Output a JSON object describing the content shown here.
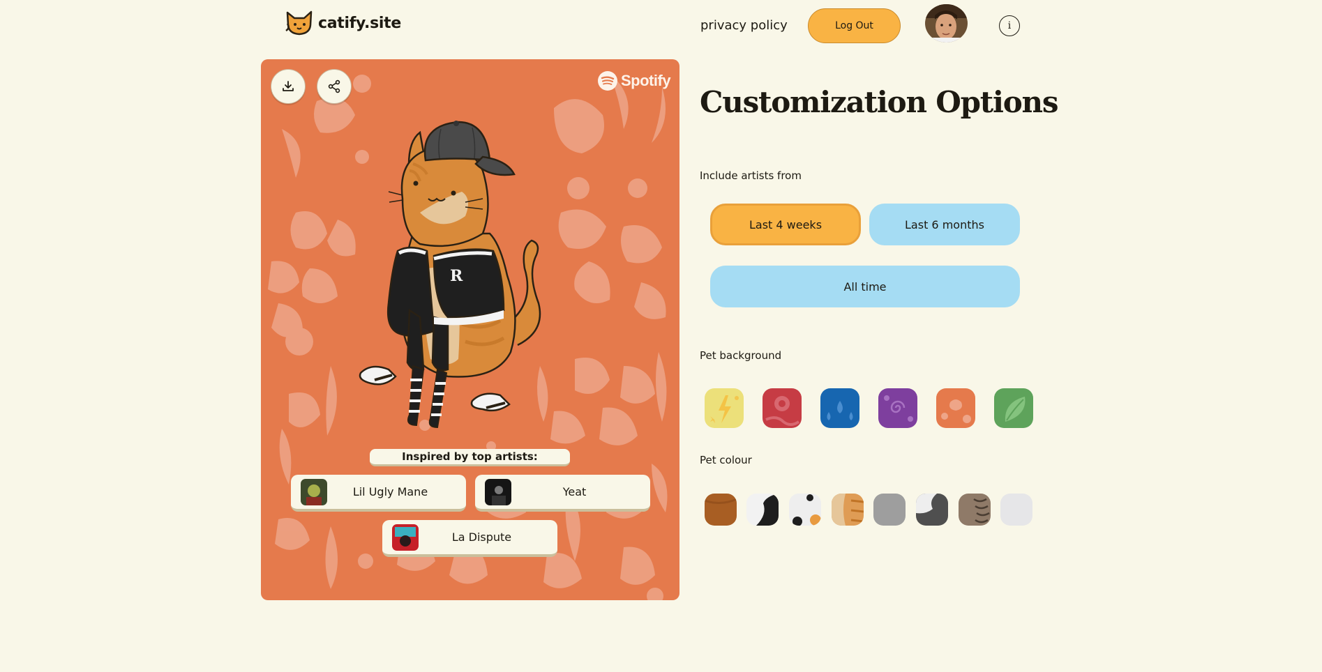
{
  "header": {
    "logo_text": "catify.site",
    "privacy_label": "privacy policy",
    "logout_label": "Log Out",
    "info_label": "i"
  },
  "card": {
    "download_icon": "download-icon",
    "share_icon": "share-icon",
    "spotify_label": "Spotify",
    "inspired_label": "Inspired by top artists:",
    "artists": [
      {
        "name": "Lil Ugly Mane"
      },
      {
        "name": "Yeat"
      },
      {
        "name": "La Dispute"
      }
    ]
  },
  "options": {
    "title": "Customization Options",
    "artists_label": "Include artists from",
    "time_ranges": [
      {
        "label": "Last 4 weeks",
        "selected": true
      },
      {
        "label": "Last 6 months",
        "selected": false
      },
      {
        "label": "All time",
        "selected": false
      }
    ],
    "background_label": "Pet background",
    "backgrounds": [
      {
        "name": "yellow-lightning",
        "color": "#ece07a"
      },
      {
        "name": "red-pattern",
        "color": "#c63c44"
      },
      {
        "name": "blue-drops",
        "color": "#1766b0"
      },
      {
        "name": "purple-swirl",
        "color": "#7e3f9e"
      },
      {
        "name": "orange-flowers",
        "color": "#e57a4c"
      },
      {
        "name": "green-leaves",
        "color": "#5ea35b"
      }
    ],
    "colour_label": "Pet colour",
    "colours": [
      {
        "name": "brown",
        "color": "#a85e23"
      },
      {
        "name": "black-white",
        "color": "#1e1e1e"
      },
      {
        "name": "white-calico",
        "color": "#eeeeee"
      },
      {
        "name": "orange-cream",
        "color": "#df9c55"
      },
      {
        "name": "grey",
        "color": "#9e9e9e"
      },
      {
        "name": "grey-white",
        "color": "#4f4f4f"
      },
      {
        "name": "tabby-brown",
        "color": "#8f7a68"
      },
      {
        "name": "light-grey",
        "color": "#e6e6e8"
      }
    ]
  },
  "colors": {
    "page_bg": "#f9f7e8",
    "accent_orange": "#f9b344",
    "accent_blue": "#a5dcf3",
    "card_bg": "#e57a4c"
  }
}
